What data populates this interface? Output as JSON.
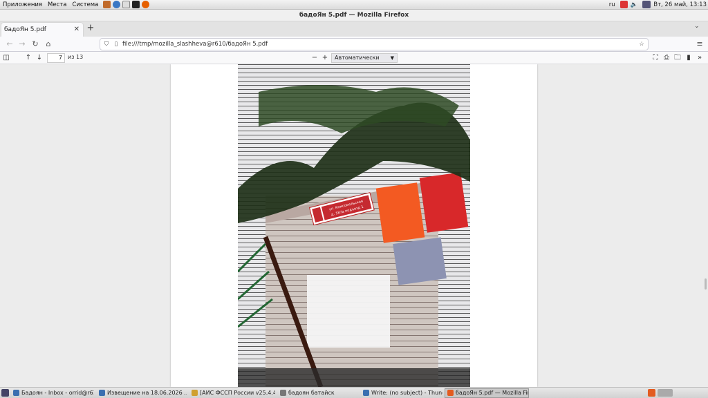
{
  "top_panel": {
    "menus": [
      "Приложения",
      "Места",
      "Система"
    ],
    "launchers": [
      "thunderbird-icon",
      "browser-icon",
      "editor-icon",
      "terminal-icon",
      "firefox-icon"
    ],
    "tray": {
      "lang": "ru",
      "clock": "Вт, 26 май, 13:13"
    }
  },
  "window": {
    "title": "бадоЯн 5.pdf — Mozilla Firefox"
  },
  "tabs": [
    {
      "label": "бадоЯн 5.pdf"
    }
  ],
  "nav": {
    "url": "file:///tmp/mozilla_slashheva@r610/бадоЯн 5.pdf"
  },
  "pdf": {
    "page": "7",
    "of": "из 13",
    "zoom": "Автоматически"
  },
  "photo": {
    "sign_text_1": "ул. Комсомольская",
    "sign_text_2": "д. 187а подъезд 1"
  },
  "taskbar": {
    "items": [
      {
        "label": "Бадоян - Inbox - orrid@r61...",
        "color": "#3a6fb0"
      },
      {
        "label": "Извещение на 18.06.2026 ...",
        "color": "#3a6fb0"
      },
      {
        "label": "[АИС ФССП России v25.4.4...",
        "color": "#d0a030"
      },
      {
        "label": "бадоян батайск",
        "color": "#777777"
      },
      {
        "label": "Write: (no subject) - Thunde...",
        "color": "#3a6fb0"
      },
      {
        "label": "бадоЯн 5.pdf — Mozilla Fire...",
        "color": "#e35b20"
      }
    ]
  }
}
